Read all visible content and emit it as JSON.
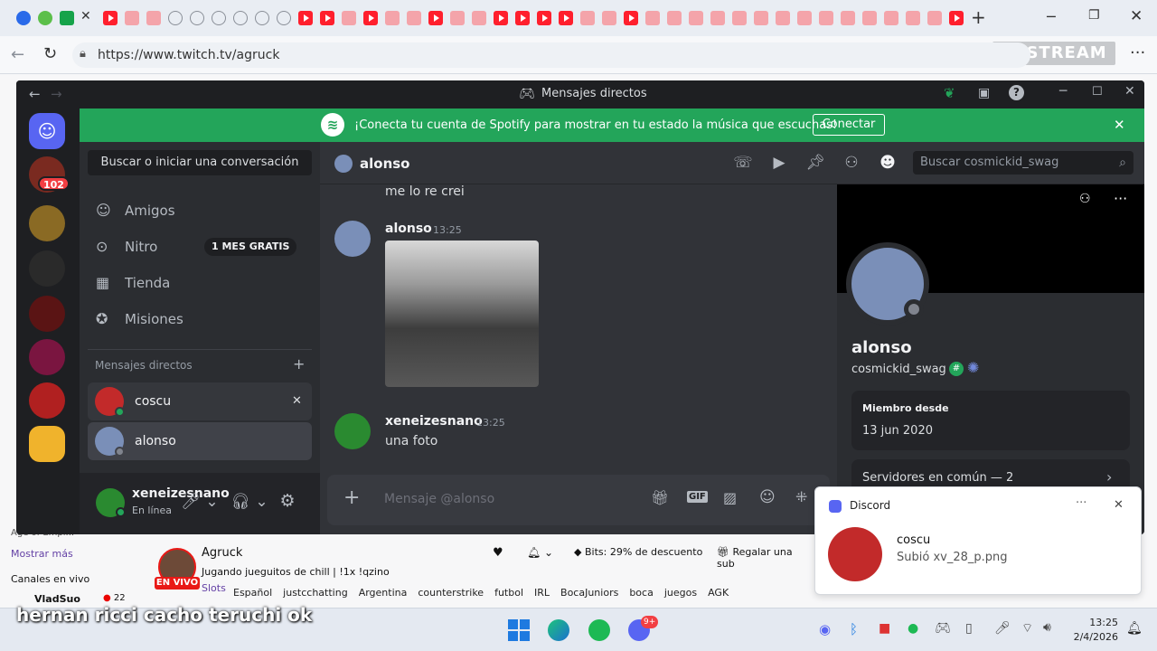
{
  "browser": {
    "url": "https://www.twitch.tv/agruck",
    "restream_label": "RESTREAM"
  },
  "discord": {
    "window_title": "Mensajes directos",
    "spotify_banner": {
      "text": "¡Conecta tu cuenta de Spotify para mostrar en tu estado la música que escuchas!",
      "button": "Conectar"
    },
    "guild_badge": "102",
    "search_button": "Buscar o iniciar una conversación",
    "nav": [
      {
        "label": "Amigos",
        "icon": "friends-icon"
      },
      {
        "label": "Nitro",
        "icon": "nitro-icon",
        "badge": "1 MES GRATIS"
      },
      {
        "label": "Tienda",
        "icon": "shop-icon"
      },
      {
        "label": "Misiones",
        "icon": "quests-icon"
      }
    ],
    "dm_header": "Mensajes directos",
    "dms": [
      {
        "name": "coscu"
      },
      {
        "name": "alonso"
      }
    ],
    "user": {
      "name": "xeneizesnano",
      "status": "En línea"
    },
    "chat_header": {
      "name": "alonso",
      "search_placeholder": "Buscar cosmickid_swag"
    },
    "messages": [
      {
        "author": "",
        "time": "",
        "text": "me lo re crei"
      },
      {
        "author": "alonso",
        "time": "13:25",
        "text": ""
      },
      {
        "author": "xeneizesnano",
        "time": "13:25",
        "text": "una foto"
      }
    ],
    "message_placeholder": "Mensaje @alonso",
    "profile": {
      "display_name": "alonso",
      "username": "cosmickid_swag",
      "member_since_label": "Miembro desde",
      "member_since": "13 jun 2020",
      "servers": "Servidores en común — 2"
    }
  },
  "twitch": {
    "sidebar_partial": "Age of Empi...",
    "show_more": "Mostrar más",
    "live_channels": "Canales en vivo",
    "channel_row": {
      "name": "VladSuo",
      "viewers": "22"
    },
    "streamer": "Agruck",
    "stream_title": "Jugando jueguitos de chill | !1x !qzino",
    "live_badge": "EN VIVO",
    "category": "Slots",
    "tags": [
      "Español",
      "justcchatting",
      "Argentina",
      "counterstrike",
      "futbol",
      "IRL",
      "BocaJuniors",
      "boca",
      "juegos",
      "AGK"
    ],
    "bits": "Bits: 29% de descuento",
    "gift": "Regalar una sub"
  },
  "notification": {
    "app": "Discord",
    "title": "coscu",
    "body": "Subió xv_28_p.png"
  },
  "caption": "hernan ricci cacho teruchi ok",
  "taskbar": {
    "time": "13:25",
    "date": "2/4/2026",
    "discord_badge": "9+"
  }
}
